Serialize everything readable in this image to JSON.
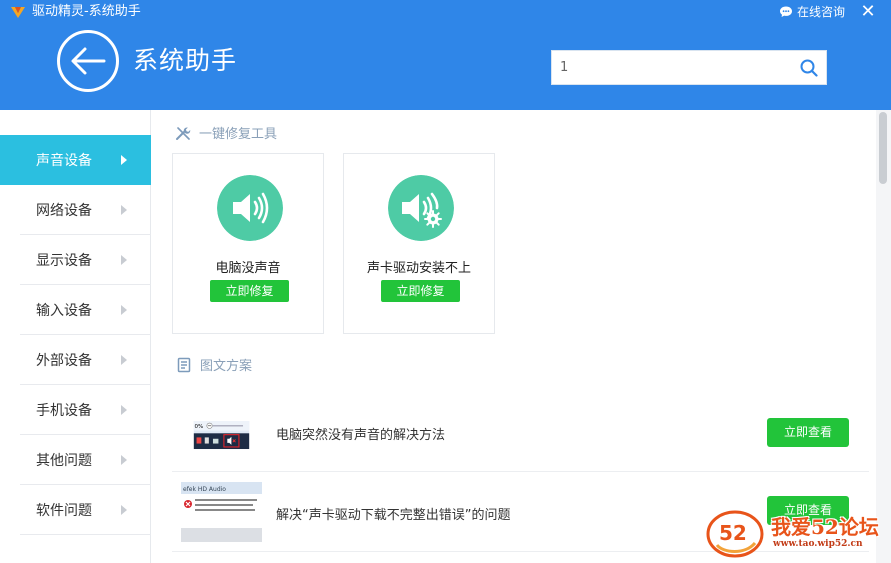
{
  "window": {
    "title": "驱动精灵-系统助手",
    "consult_label": "在线咨询",
    "close_glyph": "✕"
  },
  "header": {
    "page_title": "系统助手",
    "search_value": "1"
  },
  "sidebar": {
    "items": [
      {
        "label": "声音设备",
        "active": true
      },
      {
        "label": "网络设备",
        "active": false
      },
      {
        "label": "显示设备",
        "active": false
      },
      {
        "label": "输入设备",
        "active": false
      },
      {
        "label": "外部设备",
        "active": false
      },
      {
        "label": "手机设备",
        "active": false
      },
      {
        "label": "其他问题",
        "active": false
      },
      {
        "label": "软件问题",
        "active": false
      }
    ]
  },
  "repair_section": {
    "title": "一键修复工具",
    "cards": [
      {
        "label": "电脑没声音",
        "button": "立即修复",
        "icon": "speaker-icon"
      },
      {
        "label": "声卡驱动安装不上",
        "button": "立即修复",
        "icon": "speaker-gear-icon"
      }
    ]
  },
  "article_section": {
    "title": "图文方案",
    "articles": [
      {
        "title": "电脑突然没有声音的解决方法",
        "button": "立即查看"
      },
      {
        "title": "解决“声卡驱动下载不完整出错误”的问题",
        "button": "立即查看"
      }
    ]
  },
  "watermark": {
    "text": "我爱52论坛",
    "url": "www.tao.wip52.cn",
    "badge": "52"
  },
  "colors": {
    "header_blue": "#2f86e8",
    "sidebar_active": "#2bbfe0",
    "button_green": "#22c43a",
    "icon_teal": "#4ecba5"
  }
}
